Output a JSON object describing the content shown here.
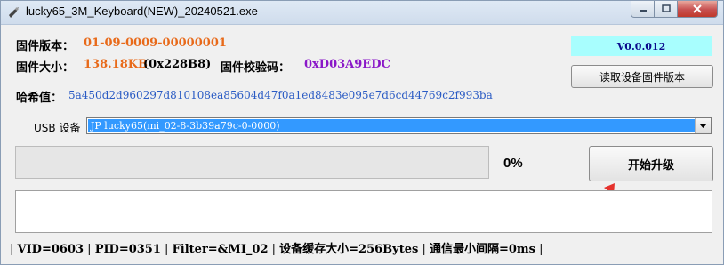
{
  "window": {
    "title": "lucky65_3M_Keyboard(NEW)_20240521.exe",
    "icon": "app-icon"
  },
  "firmware": {
    "version_label": "固件版本：",
    "version_value": "01-09-0009-00000001",
    "size_label": "固件大小：",
    "size_value_kb": "138.18KB",
    "size_value_hex": "(0x228B8)",
    "checksum_label": "固件校验码：",
    "checksum_value": "0xD03A9EDC",
    "hash_label": "哈希值：",
    "hash_value": "5a450d2d960297d810108ea85604d47f0a1ed8483e095e7d6cd44769c2f993ba"
  },
  "app_version": "V0.0.012",
  "buttons": {
    "read_version": "读取设备固件版本",
    "start_upgrade": "开始升级"
  },
  "usb": {
    "label": "USB 设备",
    "selected": "JP lucky65(mi_02-8-3b39a79c-0-0000)"
  },
  "progress": {
    "percent_text": "0%",
    "value": 0
  },
  "status_bar": {
    "vid": "VID=0603",
    "pid": "PID=0351",
    "filter": "Filter=&MI_02",
    "buffer": "设备缓存大小=256Bytes",
    "interval": "通信最小间隔=0ms"
  },
  "colors": {
    "accent_orange": "#e86a1a",
    "accent_purple": "#8a18c8",
    "version_bg": "#a8fefe",
    "selection_blue": "#3399ff",
    "annotation_red": "#e5322d"
  }
}
